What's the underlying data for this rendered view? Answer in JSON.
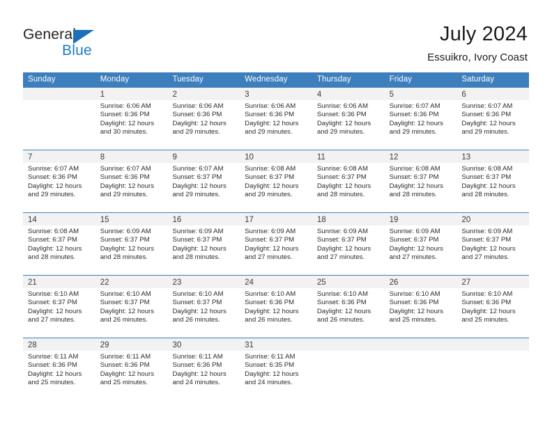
{
  "brand": {
    "name_top": "General",
    "name_bottom": "Blue",
    "accent_color": "#1c7cc4",
    "triangle_color": "#1c6fba"
  },
  "header": {
    "title": "July 2024",
    "subtitle": "Essuikro, Ivory Coast"
  },
  "calendar": {
    "header_bg": "#3d7ebd",
    "daynum_bg": "#f2f2f2",
    "weekdays": [
      "Sunday",
      "Monday",
      "Tuesday",
      "Wednesday",
      "Thursday",
      "Friday",
      "Saturday"
    ],
    "weeks": [
      [
        {
          "day": "",
          "lines": []
        },
        {
          "day": "1",
          "lines": [
            "Sunrise: 6:06 AM",
            "Sunset: 6:36 PM",
            "Daylight: 12 hours",
            "and 30 minutes."
          ]
        },
        {
          "day": "2",
          "lines": [
            "Sunrise: 6:06 AM",
            "Sunset: 6:36 PM",
            "Daylight: 12 hours",
            "and 29 minutes."
          ]
        },
        {
          "day": "3",
          "lines": [
            "Sunrise: 6:06 AM",
            "Sunset: 6:36 PM",
            "Daylight: 12 hours",
            "and 29 minutes."
          ]
        },
        {
          "day": "4",
          "lines": [
            "Sunrise: 6:06 AM",
            "Sunset: 6:36 PM",
            "Daylight: 12 hours",
            "and 29 minutes."
          ]
        },
        {
          "day": "5",
          "lines": [
            "Sunrise: 6:07 AM",
            "Sunset: 6:36 PM",
            "Daylight: 12 hours",
            "and 29 minutes."
          ]
        },
        {
          "day": "6",
          "lines": [
            "Sunrise: 6:07 AM",
            "Sunset: 6:36 PM",
            "Daylight: 12 hours",
            "and 29 minutes."
          ]
        }
      ],
      [
        {
          "day": "7",
          "lines": [
            "Sunrise: 6:07 AM",
            "Sunset: 6:36 PM",
            "Daylight: 12 hours",
            "and 29 minutes."
          ]
        },
        {
          "day": "8",
          "lines": [
            "Sunrise: 6:07 AM",
            "Sunset: 6:36 PM",
            "Daylight: 12 hours",
            "and 29 minutes."
          ]
        },
        {
          "day": "9",
          "lines": [
            "Sunrise: 6:07 AM",
            "Sunset: 6:37 PM",
            "Daylight: 12 hours",
            "and 29 minutes."
          ]
        },
        {
          "day": "10",
          "lines": [
            "Sunrise: 6:08 AM",
            "Sunset: 6:37 PM",
            "Daylight: 12 hours",
            "and 29 minutes."
          ]
        },
        {
          "day": "11",
          "lines": [
            "Sunrise: 6:08 AM",
            "Sunset: 6:37 PM",
            "Daylight: 12 hours",
            "and 28 minutes."
          ]
        },
        {
          "day": "12",
          "lines": [
            "Sunrise: 6:08 AM",
            "Sunset: 6:37 PM",
            "Daylight: 12 hours",
            "and 28 minutes."
          ]
        },
        {
          "day": "13",
          "lines": [
            "Sunrise: 6:08 AM",
            "Sunset: 6:37 PM",
            "Daylight: 12 hours",
            "and 28 minutes."
          ]
        }
      ],
      [
        {
          "day": "14",
          "lines": [
            "Sunrise: 6:08 AM",
            "Sunset: 6:37 PM",
            "Daylight: 12 hours",
            "and 28 minutes."
          ]
        },
        {
          "day": "15",
          "lines": [
            "Sunrise: 6:09 AM",
            "Sunset: 6:37 PM",
            "Daylight: 12 hours",
            "and 28 minutes."
          ]
        },
        {
          "day": "16",
          "lines": [
            "Sunrise: 6:09 AM",
            "Sunset: 6:37 PM",
            "Daylight: 12 hours",
            "and 28 minutes."
          ]
        },
        {
          "day": "17",
          "lines": [
            "Sunrise: 6:09 AM",
            "Sunset: 6:37 PM",
            "Daylight: 12 hours",
            "and 27 minutes."
          ]
        },
        {
          "day": "18",
          "lines": [
            "Sunrise: 6:09 AM",
            "Sunset: 6:37 PM",
            "Daylight: 12 hours",
            "and 27 minutes."
          ]
        },
        {
          "day": "19",
          "lines": [
            "Sunrise: 6:09 AM",
            "Sunset: 6:37 PM",
            "Daylight: 12 hours",
            "and 27 minutes."
          ]
        },
        {
          "day": "20",
          "lines": [
            "Sunrise: 6:09 AM",
            "Sunset: 6:37 PM",
            "Daylight: 12 hours",
            "and 27 minutes."
          ]
        }
      ],
      [
        {
          "day": "21",
          "lines": [
            "Sunrise: 6:10 AM",
            "Sunset: 6:37 PM",
            "Daylight: 12 hours",
            "and 27 minutes."
          ]
        },
        {
          "day": "22",
          "lines": [
            "Sunrise: 6:10 AM",
            "Sunset: 6:37 PM",
            "Daylight: 12 hours",
            "and 26 minutes."
          ]
        },
        {
          "day": "23",
          "lines": [
            "Sunrise: 6:10 AM",
            "Sunset: 6:37 PM",
            "Daylight: 12 hours",
            "and 26 minutes."
          ]
        },
        {
          "day": "24",
          "lines": [
            "Sunrise: 6:10 AM",
            "Sunset: 6:36 PM",
            "Daylight: 12 hours",
            "and 26 minutes."
          ]
        },
        {
          "day": "25",
          "lines": [
            "Sunrise: 6:10 AM",
            "Sunset: 6:36 PM",
            "Daylight: 12 hours",
            "and 26 minutes."
          ]
        },
        {
          "day": "26",
          "lines": [
            "Sunrise: 6:10 AM",
            "Sunset: 6:36 PM",
            "Daylight: 12 hours",
            "and 25 minutes."
          ]
        },
        {
          "day": "27",
          "lines": [
            "Sunrise: 6:10 AM",
            "Sunset: 6:36 PM",
            "Daylight: 12 hours",
            "and 25 minutes."
          ]
        }
      ],
      [
        {
          "day": "28",
          "lines": [
            "Sunrise: 6:11 AM",
            "Sunset: 6:36 PM",
            "Daylight: 12 hours",
            "and 25 minutes."
          ]
        },
        {
          "day": "29",
          "lines": [
            "Sunrise: 6:11 AM",
            "Sunset: 6:36 PM",
            "Daylight: 12 hours",
            "and 25 minutes."
          ]
        },
        {
          "day": "30",
          "lines": [
            "Sunrise: 6:11 AM",
            "Sunset: 6:36 PM",
            "Daylight: 12 hours",
            "and 24 minutes."
          ]
        },
        {
          "day": "31",
          "lines": [
            "Sunrise: 6:11 AM",
            "Sunset: 6:35 PM",
            "Daylight: 12 hours",
            "and 24 minutes."
          ]
        },
        {
          "day": "",
          "lines": []
        },
        {
          "day": "",
          "lines": []
        },
        {
          "day": "",
          "lines": []
        }
      ]
    ]
  }
}
